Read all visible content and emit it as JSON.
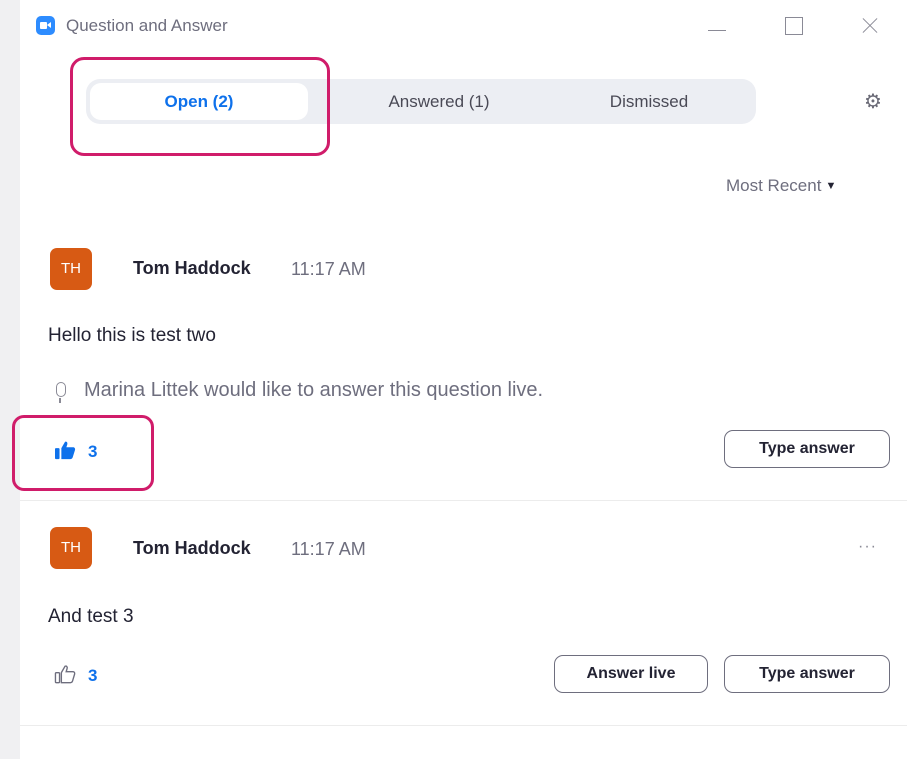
{
  "window": {
    "title": "Question and Answer"
  },
  "tabs": [
    {
      "label": "Open (2)",
      "active": true
    },
    {
      "label": "Answered (1)",
      "active": false
    },
    {
      "label": "Dismissed",
      "active": false
    }
  ],
  "sort": {
    "label": "Most Recent"
  },
  "questions": [
    {
      "avatar_initials": "TH",
      "author": "Tom Haddock",
      "time": "11:17 AM",
      "text": "Hello this is test two",
      "live_note": "Marina Littek would like to answer this question live.",
      "likes": "3",
      "liked": true,
      "actions": [
        "Type answer"
      ]
    },
    {
      "avatar_initials": "TH",
      "author": "Tom Haddock",
      "time": "11:17 AM",
      "text": "And test 3",
      "more": "···",
      "likes": "3",
      "liked": false,
      "actions": [
        "Answer live",
        "Type answer"
      ]
    }
  ],
  "colors": {
    "accent": "#0e71eb",
    "highlight": "#d01c6a",
    "avatar": "#d75a14"
  }
}
